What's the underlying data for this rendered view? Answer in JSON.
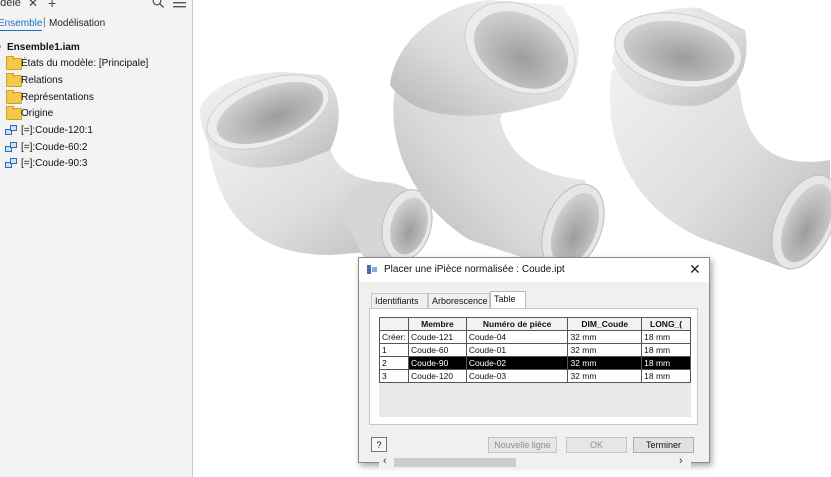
{
  "browser": {
    "title": "odèle",
    "tabs": [
      "Ensemble",
      "Modélisation"
    ],
    "tab_separator": "|",
    "root": "Ensemble1.iam",
    "items": [
      {
        "label": "États du modèle: [Principale]",
        "icon": "folder-icon"
      },
      {
        "label": "Relations",
        "icon": "folder-icon"
      },
      {
        "label": "Représentations",
        "icon": "representations-icon"
      },
      {
        "label": "Origine",
        "icon": "folder-icon"
      },
      {
        "label": "[=]:Coude-120:1",
        "icon": "occurrence-icon"
      },
      {
        "label": "[=]:Coude-60:2",
        "icon": "occurrence-icon"
      },
      {
        "label": "[=]:Coude-90:3",
        "icon": "occurrence-icon"
      }
    ]
  },
  "dialog": {
    "title": "Placer une iPièce normalisée : Coude.ipt",
    "tabs": [
      "Identifiants",
      "Arborescence",
      "Table"
    ],
    "active_tab": "Table",
    "columns": [
      "",
      "Membre",
      "Numéro de pièce",
      "DIM_Coude",
      "LONG_("
    ],
    "rows": [
      [
        "Créer:",
        "Coude-121",
        "Coude-04",
        "32 mm",
        "18 mm"
      ],
      [
        "1",
        "Coude-60",
        "Coude-01",
        "32 mm",
        "18 mm"
      ],
      [
        "2",
        "Coude-90",
        "Coude-02",
        "32 mm",
        "18 mm"
      ],
      [
        "3",
        "Coude-120",
        "Coude-03",
        "32 mm",
        "18 mm"
      ]
    ],
    "selected_row": 2,
    "help_glyph": "?",
    "buttons": {
      "new_line": "Nouvelle ligne",
      "ok": "OK",
      "finish": "Terminer"
    }
  },
  "colors": {
    "selection": "#000000",
    "active_tab": "#1a6fc4",
    "folder": "#f3c94b"
  }
}
